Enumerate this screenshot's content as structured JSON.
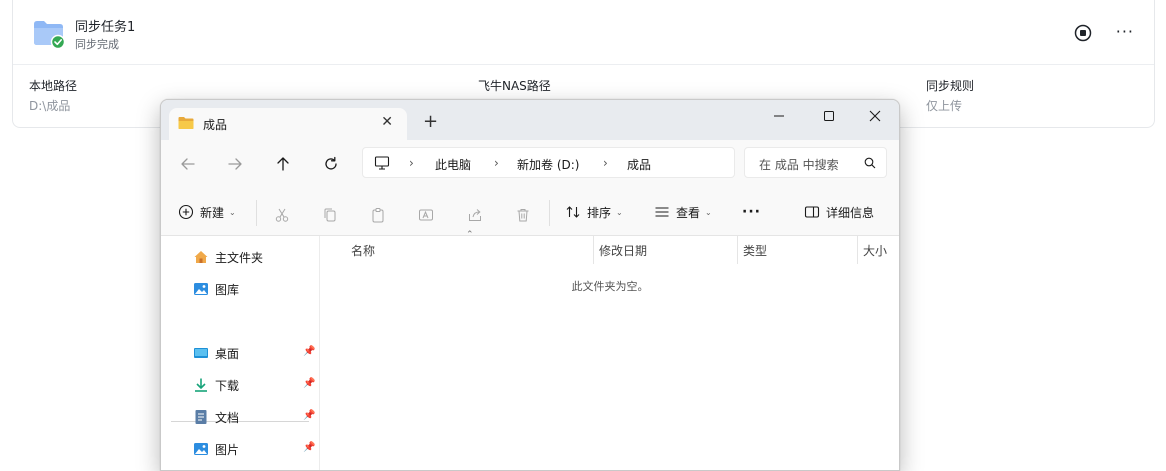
{
  "task": {
    "name": "同步任务1",
    "status": "同步完成",
    "columns": [
      {
        "title": "本地路径",
        "value": "D:\\成品"
      },
      {
        "title": "飞牛NAS路径",
        "value": ""
      },
      {
        "title": "同步规则",
        "value": "仅上传"
      }
    ],
    "more_label": "···",
    "status_color": "#34a853",
    "folder_color": "#8fb8f5"
  },
  "explorer": {
    "tab": {
      "label": "成品",
      "close": "✕",
      "new": "+"
    },
    "address": {
      "crumbs": [
        "此电脑",
        "新加卷 (D:)",
        "成品"
      ],
      "sep": "›"
    },
    "search": {
      "placeholder": "在 成品 中搜索"
    },
    "commands": {
      "new": "新建",
      "sort": "排序",
      "view": "查看",
      "more": "···",
      "details": "详细信息"
    },
    "nav": {
      "items": [
        {
          "label": "主文件夹",
          "icon": "home-icon"
        },
        {
          "label": "图库",
          "icon": "gallery-icon"
        },
        {
          "label": "桌面",
          "icon": "desktop-icon",
          "pinned": true
        },
        {
          "label": "下载",
          "icon": "download-icon",
          "pinned": true
        },
        {
          "label": "文档",
          "icon": "document-icon",
          "pinned": true
        },
        {
          "label": "图片",
          "icon": "pictures-icon",
          "pinned": true
        }
      ]
    },
    "columns": [
      "名称",
      "修改日期",
      "类型",
      "大小"
    ],
    "empty_message": "此文件夹为空。"
  }
}
